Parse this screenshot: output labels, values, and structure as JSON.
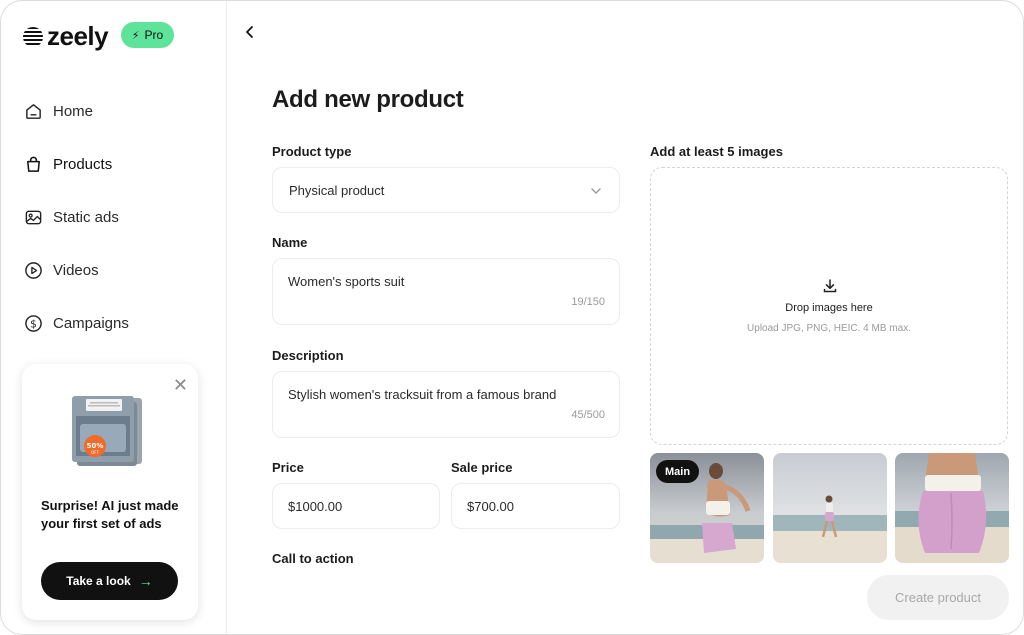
{
  "brand": {
    "name": "zeely",
    "badge": "Pro"
  },
  "sidebar": {
    "items": [
      {
        "label": "Home",
        "icon": "home-icon"
      },
      {
        "label": "Products",
        "icon": "bag-icon"
      },
      {
        "label": "Static ads",
        "icon": "image-icon"
      },
      {
        "label": "Videos",
        "icon": "play-icon"
      },
      {
        "label": "Campaigns",
        "icon": "dollar-icon"
      }
    ]
  },
  "promo": {
    "title": "Surprise! AI just made your first set of ads",
    "button": "Take a look",
    "sale_badge": "50%"
  },
  "header": {
    "title": "Add new product"
  },
  "form": {
    "product_type": {
      "label": "Product type",
      "value": "Physical product"
    },
    "name": {
      "label": "Name",
      "value": "Women's sports suit",
      "count": "19/150"
    },
    "description": {
      "label": "Description",
      "value": "Stylish women's tracksuit from a famous brand",
      "count": "45/500"
    },
    "price": {
      "label": "Price",
      "value": "$1000.00"
    },
    "sale_price": {
      "label": "Sale price",
      "value": "$700.00"
    },
    "cta": {
      "label": "Call to action"
    }
  },
  "images": {
    "label": "Add at least 5 images",
    "drop_title": "Drop images here",
    "drop_hint": "Upload JPG, PNG, HEIC. 4 MB max.",
    "main_badge": "Main"
  },
  "actions": {
    "create": "Create product"
  },
  "colors": {
    "accent": "#5ee39a",
    "dark": "#111111"
  }
}
